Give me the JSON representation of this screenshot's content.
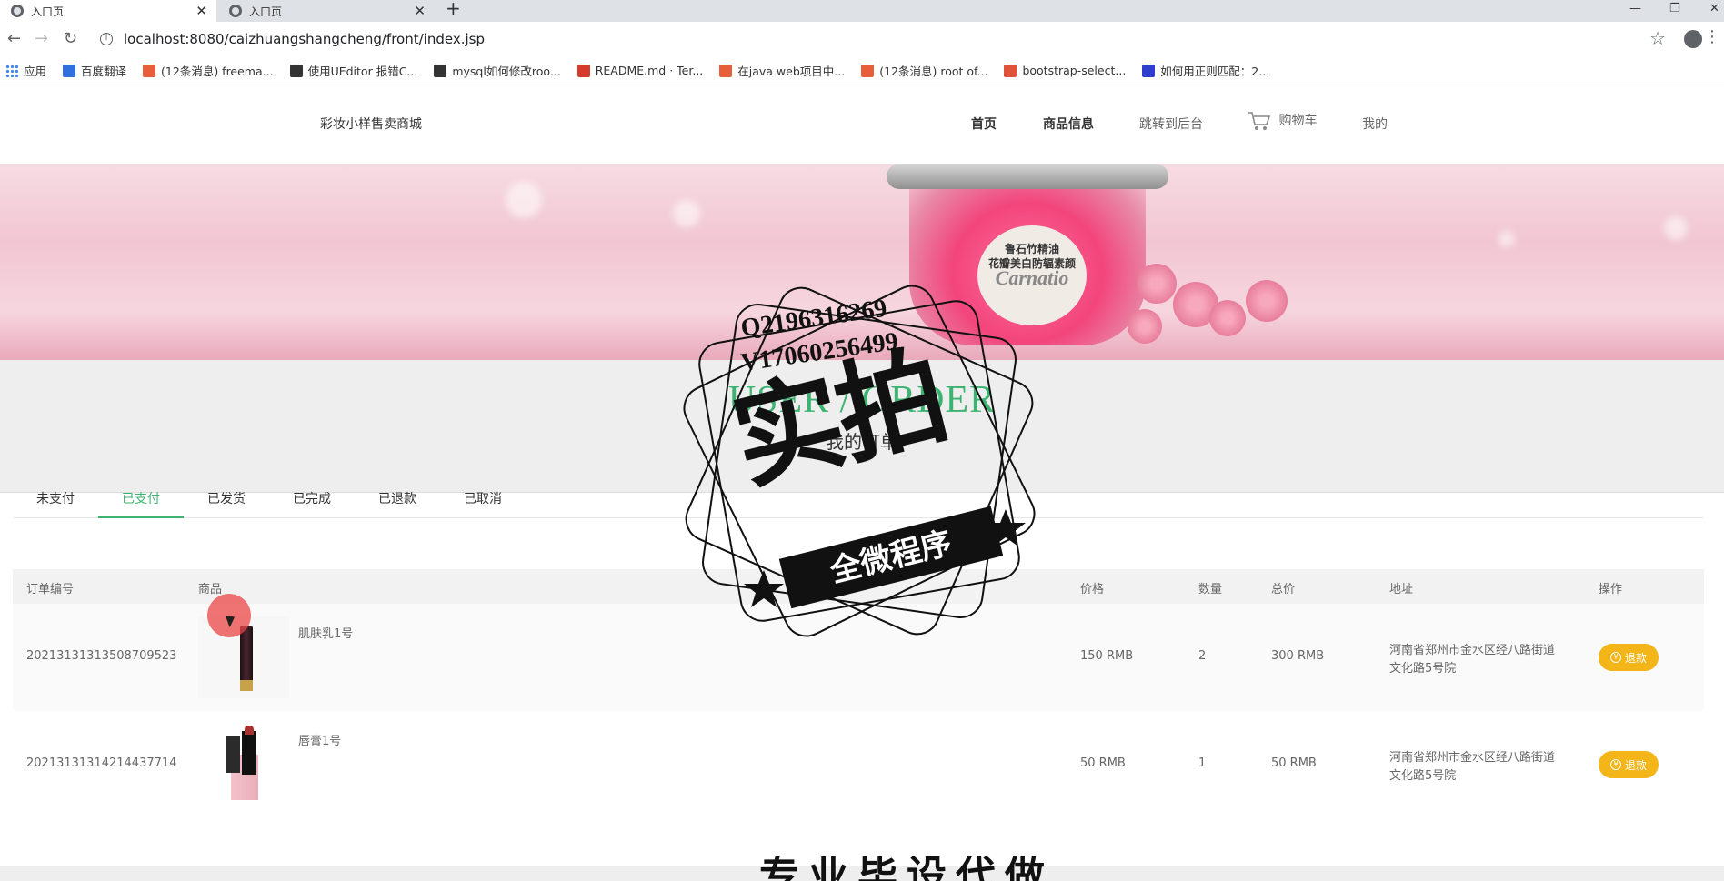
{
  "browser": {
    "tabs": [
      {
        "title": "入口页",
        "active": true
      },
      {
        "title": "入口页",
        "active": false
      }
    ],
    "url": "localhost:8080/caizhuangshangcheng/front/index.jsp",
    "bookmarks": [
      {
        "label": "应用",
        "color": "#4285f4"
      },
      {
        "label": "百度翻译",
        "color": "#2f6fe0"
      },
      {
        "label": "(12条消息) freema...",
        "color": "#e65f3a"
      },
      {
        "label": "使用UEditor 报错C...",
        "color": "#333333"
      },
      {
        "label": "mysql如何修改roo...",
        "color": "#333333"
      },
      {
        "label": "README.md · Ter...",
        "color": "#d63a2d"
      },
      {
        "label": "在java web项目中...",
        "color": "#e65f3a"
      },
      {
        "label": "(12条消息) root of...",
        "color": "#e65f3a"
      },
      {
        "label": "bootstrap-select...",
        "color": "#e0533a"
      },
      {
        "label": "如何用正则匹配：2...",
        "color": "#2f3ecc"
      }
    ]
  },
  "site": {
    "brand": "彩妆小样售卖商城",
    "nav": {
      "home": "首页",
      "products": "商品信息",
      "admin": "跳转到后台",
      "cart": "购物车",
      "mine": "我的"
    },
    "banner": {
      "product_label": "鲁石竹精油\n花瓣美白防辐素颜",
      "product_script": "Carnatio"
    },
    "page_title_en": "USER / ORDER",
    "page_title_cn": "我的订单",
    "order_tabs": [
      "未支付",
      "已支付",
      "已发货",
      "已完成",
      "已退款",
      "已取消"
    ],
    "active_tab": "已支付",
    "table": {
      "headers": {
        "order_no": "订单编号",
        "product": "商品",
        "price": "价格",
        "qty": "数量",
        "total": "总价",
        "address": "地址",
        "action": "操作"
      },
      "rows": [
        {
          "order_no": "20213131313508709523",
          "product": "肌肤乳1号",
          "price": "150 RMB",
          "qty": "2",
          "total": "300 RMB",
          "address_line1": "河南省郑州市金水区经八路街道",
          "address_line2": "文化路5号院",
          "action": "退款"
        },
        {
          "order_no": "20213131314214437714",
          "product": "唇膏1号",
          "price": "50 RMB",
          "qty": "1",
          "total": "50 RMB",
          "address_line1": "河南省郑州市金水区经八路街道",
          "address_line2": "文化路5号院",
          "action": "退款"
        }
      ]
    },
    "accent_color": "#3cb371",
    "refund_color": "#f3b517"
  },
  "watermark": {
    "line1": "Q2196316269",
    "line2": "V17060256499",
    "big": "实拍",
    "ribbon": "全微程序",
    "bottom": "专业毕设代做"
  }
}
